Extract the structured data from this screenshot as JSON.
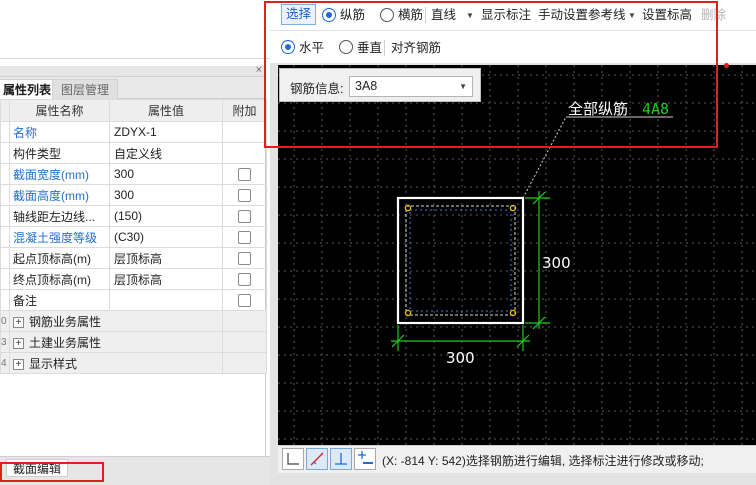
{
  "toolbar": {
    "select": "选择",
    "radio_longitudinal": "纵筋",
    "radio_transverse": "横筋",
    "line_mode": "直线",
    "show_dims": "显示标注",
    "manual_ref_line": "手动设置参考线",
    "set_elevation": "设置标高",
    "delete": "删除",
    "radio_horizontal": "水平",
    "radio_vertical": "垂直",
    "align_rebar": "对齐钢筋"
  },
  "rebar_info": {
    "label": "钢筋信息:",
    "value": "3A8"
  },
  "panel": {
    "tab_attributes": "属性列表",
    "tab_layers": "图层管理",
    "close_symbol": "×",
    "columns": [
      "属性名称",
      "属性值",
      "附加"
    ],
    "rows": [
      {
        "name": "名称",
        "value": "ZDYX-1"
      },
      {
        "name": "构件类型",
        "value": "自定义线"
      },
      {
        "name": "截面宽度(mm)",
        "value": "300"
      },
      {
        "name": "截面高度(mm)",
        "value": "300"
      },
      {
        "name": "轴线距左边线...",
        "value": "(150)"
      },
      {
        "name": "混凝土强度等级",
        "value": "(C30)"
      },
      {
        "name": "起点顶标高(m)",
        "value": "层顶标高"
      },
      {
        "name": "终点顶标高(m)",
        "value": "层顶标高"
      },
      {
        "name": "备注",
        "value": ""
      }
    ],
    "groups": [
      {
        "num": "0",
        "name": "钢筋业务属性"
      },
      {
        "num": "3",
        "name": "土建业务属性"
      },
      {
        "num": "4",
        "name": "显示样式"
      }
    ],
    "plus_symbol": "+"
  },
  "bottom_tab": "截面编辑",
  "drawing": {
    "annotation": "全部纵筋",
    "annotation_spec": "4A8",
    "dim_width": "300",
    "dim_height": "300"
  },
  "status": {
    "text": "(X: -814 Y: 542)选择钢筋进行编辑, 选择标注进行修改或移动;"
  },
  "colors": {
    "canvas_bg": "#000000",
    "section_outline": "#ffffff",
    "rebar_dim": "#22c922",
    "highlight_red": "#e0201a",
    "accent_blue": "#1a63c6"
  }
}
